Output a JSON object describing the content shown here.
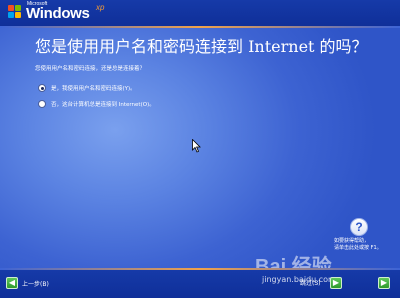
{
  "logo": {
    "microsoft": "Microsoft",
    "windows": "Windows",
    "xp": "xp"
  },
  "title": "您是使用用户名和密码连接到 Internet 的吗？",
  "question": "您使用用户名和密码连接，还是总是连接着？",
  "options": [
    {
      "label": "是，我使用用户名和密码连接(Y)。",
      "selected": true
    },
    {
      "label": "否，这台计算机总是连接到 Internet(O)。",
      "selected": false
    }
  ],
  "help": {
    "icon": "?",
    "line1": "如要获得帮助，",
    "line2": "请单击此处或按 F1。"
  },
  "nav": {
    "back_label": "上一步(B)",
    "skip_label": "跳过(S)"
  },
  "watermark": {
    "brand": "Bai 经验",
    "url": "jingyan.baidu.com"
  }
}
